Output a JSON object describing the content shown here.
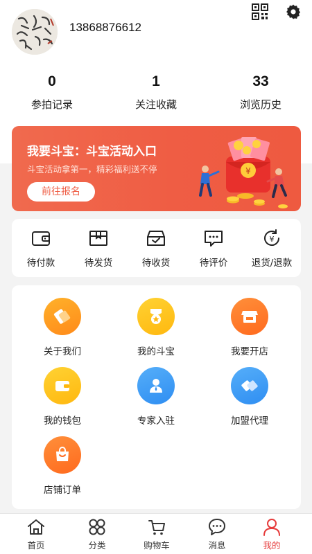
{
  "header": {
    "phone": "13868876612",
    "icons": [
      "qrcode-icon",
      "gear-icon"
    ]
  },
  "stats": [
    {
      "value": "0",
      "label": "参拍记录"
    },
    {
      "value": "1",
      "label": "关注收藏"
    },
    {
      "value": "33",
      "label": "浏览历史"
    }
  ],
  "banner": {
    "title": "我要斗宝：斗宝活动入口",
    "subtitle": "斗宝活动拿第一，精彩福利送不停",
    "button": "前往报名",
    "color": "#ef5d44"
  },
  "orders": [
    {
      "label": "待付款",
      "icon": "wallet-icon"
    },
    {
      "label": "待发货",
      "icon": "package-icon"
    },
    {
      "label": "待收货",
      "icon": "inbox-check-icon"
    },
    {
      "label": "待评价",
      "icon": "comment-icon"
    },
    {
      "label": "退货/退款",
      "icon": "refund-icon"
    }
  ],
  "services": [
    {
      "label": "关于我们",
      "icon": "handshake-icon",
      "color": "#ff9a1f"
    },
    {
      "label": "我的斗宝",
      "icon": "medal-icon",
      "color": "#ffc21a"
    },
    {
      "label": "我要开店",
      "icon": "shop-icon",
      "color": "#ff7a26"
    },
    {
      "label": "我的钱包",
      "icon": "wallet-icon",
      "color": "#ffc21a"
    },
    {
      "label": "专家入驻",
      "icon": "expert-icon",
      "color": "#3a95f4"
    },
    {
      "label": "加盟代理",
      "icon": "partnership-icon",
      "color": "#3a95f4"
    },
    {
      "label": "店铺订单",
      "icon": "shopping-bag-icon",
      "color": "#ff8a1a"
    }
  ],
  "tabbar": [
    {
      "label": "首页",
      "icon": "home-icon",
      "active": false
    },
    {
      "label": "分类",
      "icon": "category-icon",
      "active": false
    },
    {
      "label": "购物车",
      "icon": "cart-icon",
      "active": false
    },
    {
      "label": "消息",
      "icon": "message-icon",
      "active": false
    },
    {
      "label": "我的",
      "icon": "user-icon",
      "active": true
    }
  ],
  "accent_color": "#e63b3b"
}
